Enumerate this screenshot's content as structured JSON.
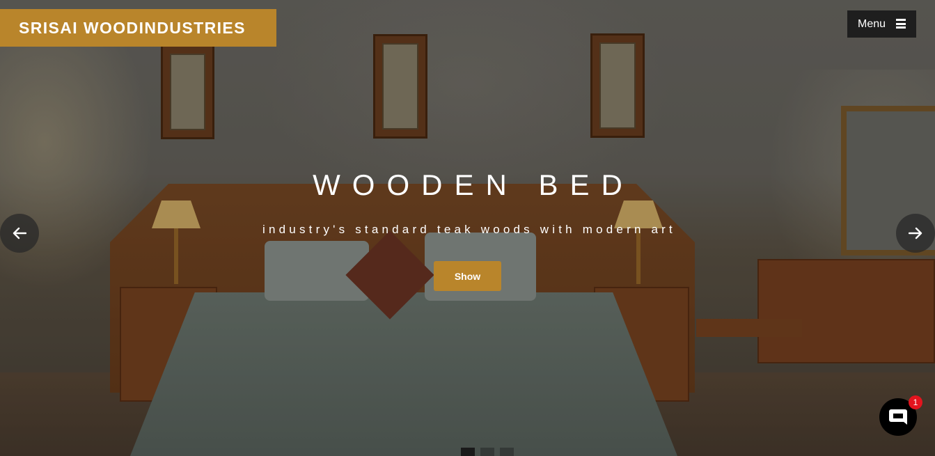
{
  "brand": {
    "name": "SRISAI WOODINDUSTRIES",
    "color": "#b9852b"
  },
  "nav": {
    "menu_label": "Menu",
    "menu_icon": "hamburger-icon"
  },
  "slide": {
    "title": "WOODEN BED",
    "subtitle": "industry's standard teak woods with modern art",
    "cta_label": "Show"
  },
  "carousel": {
    "prev_icon": "arrow-left-icon",
    "next_icon": "arrow-right-icon",
    "prev_glyph": "🡐",
    "next_glyph": "🡒",
    "dots": [
      {
        "active": true
      },
      {
        "active": false
      },
      {
        "active": false
      }
    ]
  },
  "chat": {
    "icon": "chat-bubble-icon",
    "badge_count": "1",
    "badge_color": "#e4141e"
  }
}
